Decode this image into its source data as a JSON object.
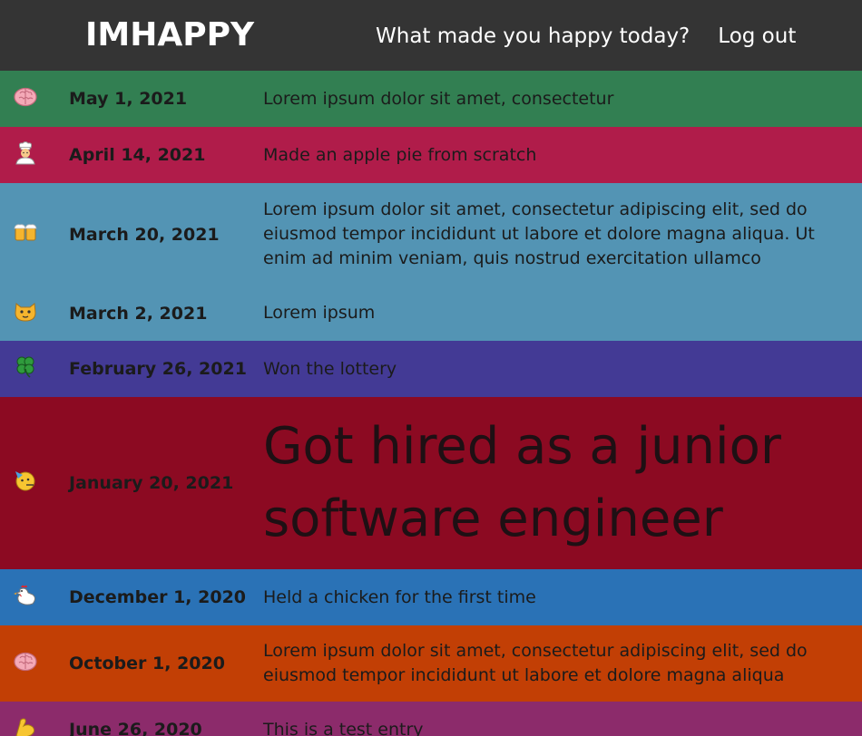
{
  "navbar": {
    "brand": "IMHAPPY",
    "links": [
      {
        "label": "What made you happy today?"
      },
      {
        "label": "Log out"
      }
    ]
  },
  "entries": [
    {
      "icon": "brain-icon",
      "date": "May 1, 2021",
      "text": "Lorem ipsum dolor sit amet, consectetur",
      "color": "#327f52"
    },
    {
      "icon": "cook-icon",
      "date": "April 14, 2021",
      "text": "Made an apple pie from scratch",
      "color": "#b01c4a"
    },
    {
      "icon": "beer-mugs-icon",
      "date": "March 20, 2021",
      "text": "Lorem ipsum dolor sit amet, consectetur adipiscing elit, sed do eiusmod tempor incididunt ut labore et dolore magna aliqua. Ut enim ad minim veniam, quis nostrud exercitation ullamco",
      "color": "#5394b4"
    },
    {
      "icon": "cat-face-icon",
      "date": "March 2, 2021",
      "text": "Lorem ipsum",
      "color": "#5394b4"
    },
    {
      "icon": "four-leaf-clover-icon",
      "date": "February 26, 2021",
      "text": "Won the lottery",
      "color": "#433a95"
    },
    {
      "icon": "party-face-icon",
      "date": "January 20, 2021",
      "text": "Got hired as a junior software engineer",
      "color": "#8c0a22"
    },
    {
      "icon": "rooster-icon",
      "date": "December 1, 2020",
      "text": "Held a chicken for the first time",
      "color": "#2a72b6"
    },
    {
      "icon": "brain-icon",
      "date": "October 1, 2020",
      "text": "Lorem ipsum dolor sit amet, consectetur adipiscing elit, sed do eiusmod tempor incididunt ut labore et dolore magna aliqua",
      "color": "#c23f05"
    },
    {
      "icon": "flexed-biceps-icon",
      "date": "June 26, 2020",
      "text": "This is a test entry",
      "color": "#8c2b6b"
    }
  ]
}
